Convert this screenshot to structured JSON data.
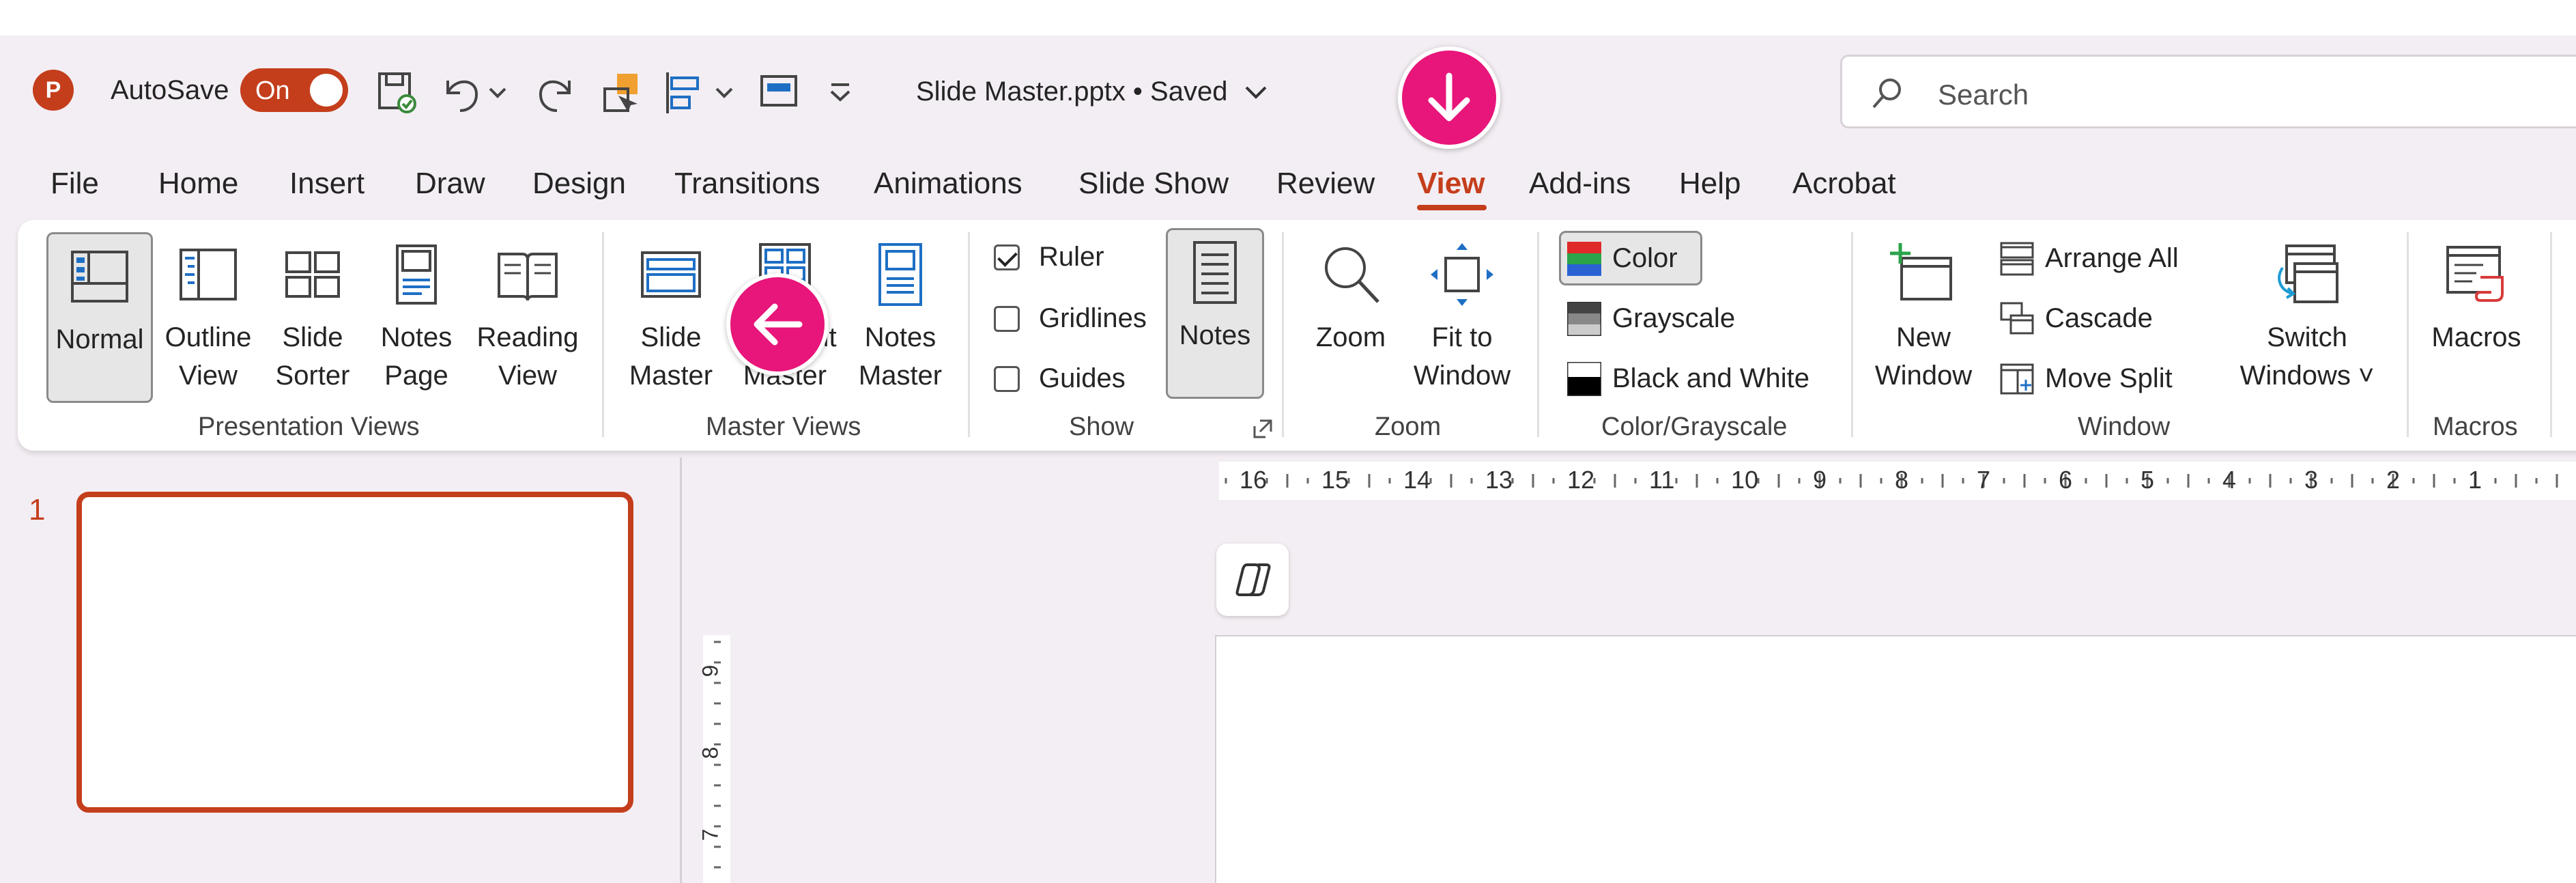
{
  "titlebar": {
    "app_logo": "P",
    "autosave_label": "AutoSave",
    "autosave_state": "On",
    "document_title": "Slide Master.pptx • Saved",
    "search_placeholder": "Search",
    "qat_icons": [
      "save-icon",
      "undo-icon",
      "redo-icon",
      "shape-icon",
      "align-icon",
      "slide-layout-icon",
      "customize-qat-icon"
    ]
  },
  "tabs": [
    "File",
    "Home",
    "Insert",
    "Draw",
    "Design",
    "Transitions",
    "Animations",
    "Slide Show",
    "Review",
    "View",
    "Add-ins",
    "Help",
    "Acrobat"
  ],
  "active_tab": "View",
  "ribbon": {
    "presentation_views": {
      "label": "Presentation Views",
      "buttons": [
        "Normal",
        "Outline\nView",
        "Slide\nSorter",
        "Notes\nPage",
        "Reading\nView"
      ]
    },
    "master_views": {
      "label": "Master Views",
      "buttons": [
        "Slide\nMaster",
        "Handout\nMaster",
        "Notes\nMaster"
      ]
    },
    "show": {
      "label": "Show",
      "checks": [
        {
          "label": "Ruler",
          "checked": true
        },
        {
          "label": "Gridlines",
          "checked": false
        },
        {
          "label": "Guides",
          "checked": false
        }
      ],
      "notes_button": "Notes"
    },
    "zoom": {
      "label": "Zoom",
      "buttons": [
        "Zoom",
        "Fit to\nWindow"
      ]
    },
    "color_grayscale": {
      "label": "Color/Grayscale",
      "options": [
        "Color",
        "Grayscale",
        "Black and White"
      ]
    },
    "window": {
      "label": "Window",
      "new_window": "New\nWindow",
      "small": [
        "Arrange All",
        "Cascade",
        "Move Split"
      ],
      "switch_windows": "Switch\nWindows ˅"
    },
    "macros": {
      "label": "Macros",
      "button": "Macros"
    }
  },
  "slides_pane": {
    "slide_number": "1"
  },
  "ruler": {
    "h_numbers": [
      "16",
      "15",
      "14",
      "13",
      "12",
      "11",
      "10",
      "9",
      "8",
      "7",
      "6",
      "5",
      "4",
      "3",
      "2",
      "1"
    ],
    "v_numbers": [
      "9",
      "8",
      "7"
    ]
  },
  "colors": {
    "accent": "#c43e1c",
    "marker": "#e8157a",
    "background": "#f3eef3"
  }
}
